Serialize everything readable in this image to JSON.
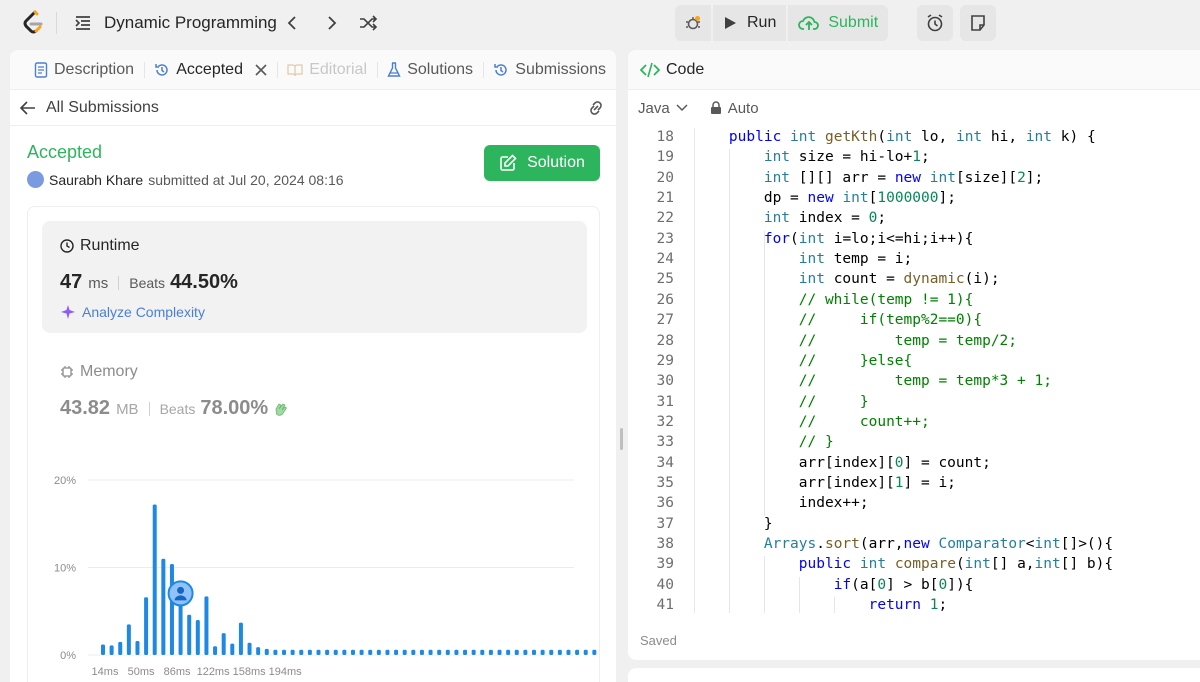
{
  "header": {
    "problem_title": "Dynamic Programming",
    "run_label": "Run",
    "submit_label": "Submit"
  },
  "left_tabs": [
    {
      "label": "Description"
    },
    {
      "label": "Accepted"
    },
    {
      "label": "Editorial"
    },
    {
      "label": "Solutions"
    },
    {
      "label": "Submissions"
    }
  ],
  "submission": {
    "back_label": "All Submissions",
    "status": "Accepted",
    "author": "Saurabh Khare",
    "submitted_text": "submitted at Jul 20, 2024 08:16",
    "solution_button": "Solution"
  },
  "runtime": {
    "label": "Runtime",
    "value": "47",
    "unit": "ms",
    "beats_label": "Beats",
    "beats_value": "44.50%",
    "analyze_label": "Analyze Complexity"
  },
  "memory": {
    "label": "Memory",
    "value": "43.82",
    "unit": "MB",
    "beats_label": "Beats",
    "beats_value": "78.00%"
  },
  "chart_data": {
    "type": "bar",
    "yticks": [
      "20%",
      "10%",
      "0%"
    ],
    "ylim": [
      0,
      20
    ],
    "xticks": [
      "14ms",
      "50ms",
      "86ms",
      "122ms",
      "158ms",
      "194ms"
    ],
    "values": [
      1.2,
      1.1,
      1.5,
      3.5,
      1.6,
      6.6,
      17.2,
      11.0,
      10.4,
      7.5,
      4.6,
      4.0,
      6.7,
      1.0,
      2.5,
      1.3,
      3.7,
      1.4,
      0.9,
      0.7,
      0.6,
      0.6,
      0.6,
      0.6,
      0.6,
      0.6,
      0.6,
      0.6,
      0.6,
      0.6,
      0.6,
      0.6,
      0.6,
      0.6,
      0.6,
      0.6,
      0.6,
      0.6,
      0.6,
      0.6,
      0.6,
      0.6,
      0.6,
      0.6,
      0.6,
      0.6,
      0.6,
      0.6,
      0.6,
      0.6,
      0.6,
      0.6,
      0.6,
      0.6,
      0.6,
      0.6,
      0.6,
      0.6
    ],
    "highlight_index": 9,
    "bar_color": "#1e88e5"
  },
  "code_panel": {
    "title": "Code",
    "language": "Java",
    "mode": "Auto",
    "status": "Saved",
    "start_line": 18,
    "lines": [
      "    public int getKth(int lo, int hi, int k) {",
      "        int size = hi-lo+1;",
      "        int [][] arr = new int[size][2];",
      "        dp = new int[1000000];",
      "        int index = 0;",
      "        for(int i=lo;i<=hi;i++){",
      "            int temp = i;",
      "            int count = dynamic(i);",
      "            // while(temp != 1){",
      "            //     if(temp%2==0){",
      "            //         temp = temp/2;",
      "            //     }else{",
      "            //         temp = temp*3 + 1;",
      "            //     }",
      "            //     count++;",
      "            // }",
      "            arr[index][0] = count;",
      "            arr[index][1] = i;",
      "            index++;",
      "        }",
      "        Arrays.sort(arr,new Comparator<int[]>(){",
      "            public int compare(int[] a,int[] b){",
      "                if(a[0] > b[0]){",
      "                    return 1;"
    ]
  }
}
